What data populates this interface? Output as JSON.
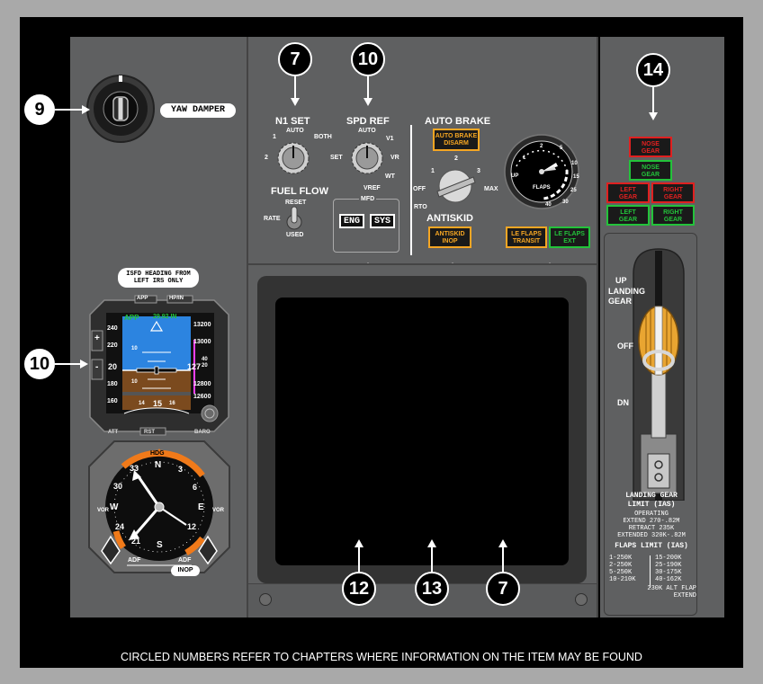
{
  "footer_note": "CIRCLED NUMBERS REFER TO CHAPTERS WHERE INFORMATION ON THE ITEM MAY BE FOUND",
  "callouts": {
    "yaw_damper": "9",
    "isfd": "10",
    "n1_set": "7",
    "spd_ref": "10",
    "mfd": "7",
    "autobrake": "14",
    "le_flaps": "9",
    "gear_lights": "14",
    "display_left": "12",
    "display_center": "13",
    "display_right": "7"
  },
  "yaw_damper": {
    "label": "YAW DAMPER"
  },
  "isfd": {
    "placard": "ISFD HEADING FROM\nLEFT IRS ONLY",
    "top_buttons": [
      "APP",
      "HP/IN"
    ],
    "mode": "APP",
    "baro": "29.92 IN",
    "speed_tape": [
      "240",
      "220",
      "200",
      "180",
      "160"
    ],
    "speed_current": "20",
    "alt_tape": [
      "13200",
      "13000",
      "12800",
      "12600"
    ],
    "alt_current": "127",
    "alt_sub": "40 20",
    "pitch_marks": [
      "10",
      "10"
    ],
    "heading": "15",
    "heading_ticks": [
      "14",
      "16"
    ],
    "bottom_labels": {
      "left": "ATT",
      "center": "RST",
      "right": "BARO"
    },
    "side_buttons": [
      "+",
      "-"
    ]
  },
  "rmi": {
    "heading_label": "HDG",
    "card_numbers": [
      "33",
      "N",
      "3",
      "6",
      "E",
      "12",
      "S",
      "21",
      "W",
      "30",
      "24"
    ],
    "left_vor": "VOR",
    "right_vor": "VOR",
    "adf_left": "ADF",
    "adf_right": "ADF",
    "inop": "INOP"
  },
  "n1_set": {
    "title": "N1 SET",
    "positions": [
      "AUTO",
      "1",
      "2",
      "BOTH"
    ]
  },
  "spd_ref": {
    "title": "SPD REF",
    "positions": [
      "AUTO",
      "V1",
      "VR",
      "WT",
      "VREF",
      "SET"
    ]
  },
  "fuel_flow": {
    "title": "FUEL FLOW",
    "positions": [
      "RESET",
      "RATE",
      "USED"
    ]
  },
  "mfd": {
    "title": "MFD",
    "buttons": [
      "ENG",
      "SYS"
    ]
  },
  "autobrake": {
    "title": "AUTO BRAKE",
    "disarm": "AUTO BRAKE\nDISARM",
    "positions": [
      "1",
      "2",
      "3",
      "OFF",
      "MAX",
      "RTO"
    ],
    "antiskid_title": "ANTISKID",
    "antiskid_inop": "ANTISKID\nINOP"
  },
  "flaps": {
    "title": "FLAPS",
    "marks": [
      "UP",
      "1",
      "2",
      "5",
      "10",
      "15",
      "25",
      "30",
      "40"
    ],
    "le_transit": "LE FLAPS\nTRANSIT",
    "le_ext": "LE FLAPS\nEXT"
  },
  "gear_lights": {
    "nose_red": "NOSE\nGEAR",
    "nose_green": "NOSE\nGEAR",
    "left_red": "LEFT\nGEAR",
    "right_red": "RIGHT\nGEAR",
    "left_green": "LEFT\nGEAR",
    "right_green": "RIGHT\nGEAR"
  },
  "gear_lever": {
    "vertical_label": "LANDING GEAR",
    "positions": [
      "UP",
      "OFF",
      "DN"
    ],
    "limit_title": "LANDING GEAR\nLIMIT (IAS)",
    "limit_lines": [
      "OPERATING",
      "EXTEND 270-.82M",
      "RETRACT 235K",
      "EXTENDED 320K-.82M"
    ],
    "flaps_title": "FLAPS LIMIT (IAS)",
    "flaps_left": [
      "1-250K",
      "2-250K",
      "5-250K",
      "10-210K"
    ],
    "flaps_right": [
      "15-200K",
      "25-190K",
      "30-175K",
      "40-162K"
    ],
    "alt_flap": "230K ALT FLAP\nEXTEND"
  },
  "colors": {
    "panel": "#5f6061",
    "amber": "#f5a623",
    "red": "#e02020",
    "green": "#23c23a",
    "sky": "#2c84e0",
    "ground": "#7b4a1e",
    "rmi_orange": "#f07a1a"
  }
}
